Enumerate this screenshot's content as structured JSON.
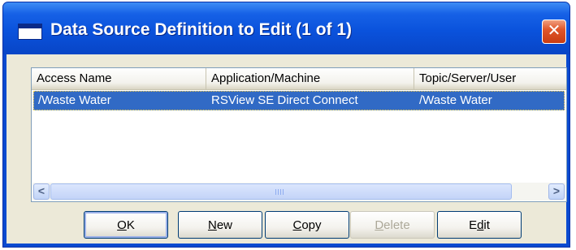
{
  "window": {
    "title": "Data Source Definition to Edit (1 of 1)",
    "close_glyph": "✕",
    "icon": "window-icon"
  },
  "listview": {
    "columns": [
      "Access Name",
      "Application/Machine",
      "Topic/Server/User"
    ],
    "rows": [
      {
        "access_name": "/Waste Water",
        "application": "RSView SE Direct Connect",
        "topic": "/Waste Water",
        "selected": true
      }
    ],
    "scroll_left": "<",
    "scroll_right": ">"
  },
  "buttons": {
    "ok": {
      "mnemonic": "O",
      "rest": "K"
    },
    "new": {
      "mnemonic": "N",
      "rest": "ew"
    },
    "copy": {
      "mnemonic": "C",
      "rest": "opy"
    },
    "delete": {
      "mnemonic": "D",
      "rest": "elete",
      "enabled": false
    },
    "edit": {
      "pre": "E",
      "mnemonic": "d",
      "rest": "it"
    }
  },
  "colors": {
    "title_bar": "#0a52dc",
    "selection": "#316ac5",
    "dialog_face": "#ece9d8",
    "close_button": "#e0562a"
  }
}
